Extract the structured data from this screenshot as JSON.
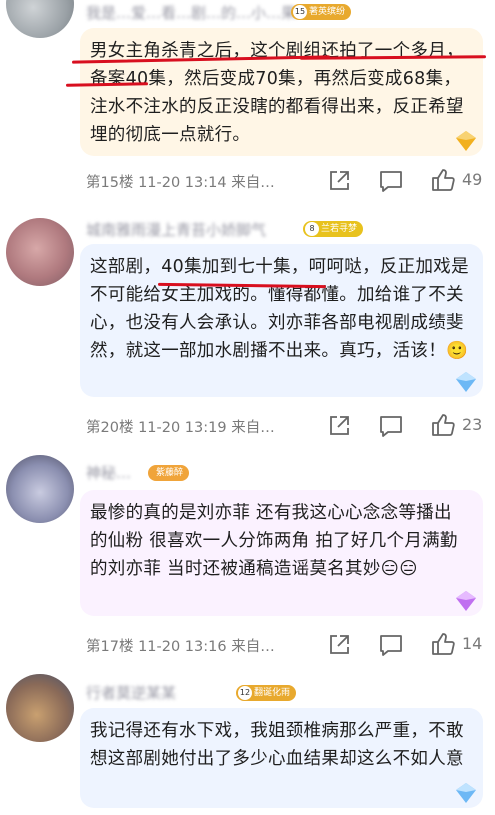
{
  "posts": [
    {
      "username": "我是…爱…看…剧…的…小…果",
      "badge": {
        "level": "15",
        "label": "著英缤纷",
        "color": "#e8a92e"
      },
      "text": "男女主角杀青之后，这个剧组还拍了一个多月，备案40集，然后变成70集，再然后变成68集，注水不注水的反正没瞎的都看得出来，反正希望埋的彻底一点就行。",
      "floor": "第15楼",
      "time": "11-20 13:14",
      "source": "来自…",
      "likes": "49",
      "bubble_color": "#fff6e6",
      "gem_color": "#f2b01e"
    },
    {
      "username": "城南雅雨漫上青苔小娇脚气",
      "badge": {
        "level": "8",
        "label": "兰若寻梦",
        "color": "#e8c21e"
      },
      "text": "这部剧，40集加到七十集，呵呵哒，反正加戏是不可能给女主加戏的。懂得都懂。加给谁了不关心，也没有人会承认。刘亦菲各部电视剧成绩斐然，就这一部加水剧播不出来。真巧，活该！🙂",
      "floor": "第20楼",
      "time": "11-20 13:19",
      "source": "来自…",
      "likes": "23",
      "bubble_color": "#eef4ff",
      "gem_color": "#6db8f5"
    },
    {
      "username": "神秘…",
      "badge": {
        "level": "",
        "label": "紫藤醉",
        "color": "#f0a43a"
      },
      "text": "最惨的真的是刘亦菲 还有我这心心念念等播出的仙粉 很喜欢一人分饰两角 拍了好几个月满勤的刘亦菲 当时还被通稿造谣莫名其妙😑😑",
      "floor": "第17楼",
      "time": "11-20 13:16",
      "source": "来自…",
      "likes": "14",
      "bubble_color": "#fbf2ff",
      "gem_color": "#c070f0"
    },
    {
      "username": "行者莫逆某某",
      "badge": {
        "level": "12",
        "label": "翻诞化雨",
        "color": "#e8a92e"
      },
      "text": "我记得还有水下戏，我姐颈椎病那么严重，不敢想这部剧她付出了多少心血结果却这么不如人意",
      "bubble_color": "#eef4ff",
      "gem_color": "#6db8f5"
    }
  ],
  "icons": {
    "share": "share-icon",
    "comment": "comment-icon",
    "like": "thumbs-up-icon"
  }
}
